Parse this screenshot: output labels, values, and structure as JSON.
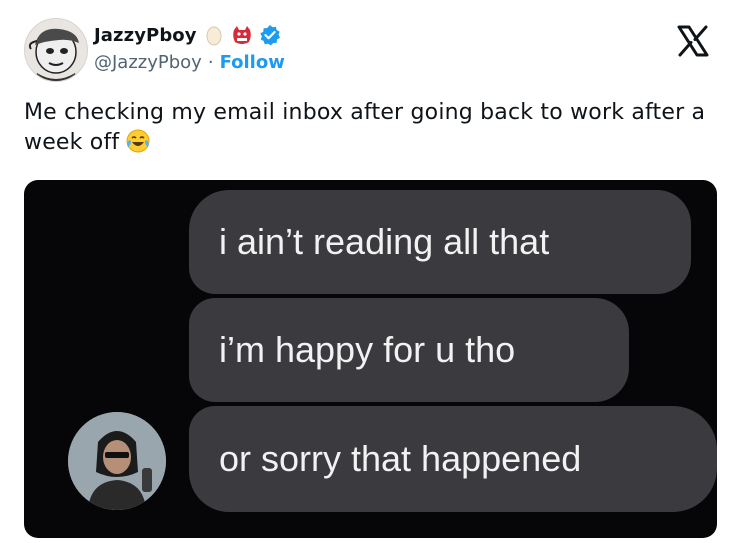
{
  "tweet": {
    "display_name": "JazzyPboy",
    "handle": "@JazzyPboy",
    "separator": "·",
    "follow_label": "Follow",
    "text": "Me checking my email inbox after going back to work after a week off",
    "text_emoji": "tears-of-joy",
    "name_emojis": [
      "egg",
      "ogre-face",
      "verified-badge"
    ],
    "x_logo": "x-logo-icon"
  },
  "media": {
    "messages": [
      "i ain’t reading all that",
      "i’m happy for u tho",
      "or sorry that happened"
    ],
    "colors": {
      "background": "#060608",
      "bubble": "#3a3a3f",
      "bubble_text": "#f2f2f2"
    }
  },
  "colors": {
    "link": "#1d9bf0",
    "muted": "#536471",
    "text": "#0f1419",
    "verified": "#1d9bf0"
  }
}
